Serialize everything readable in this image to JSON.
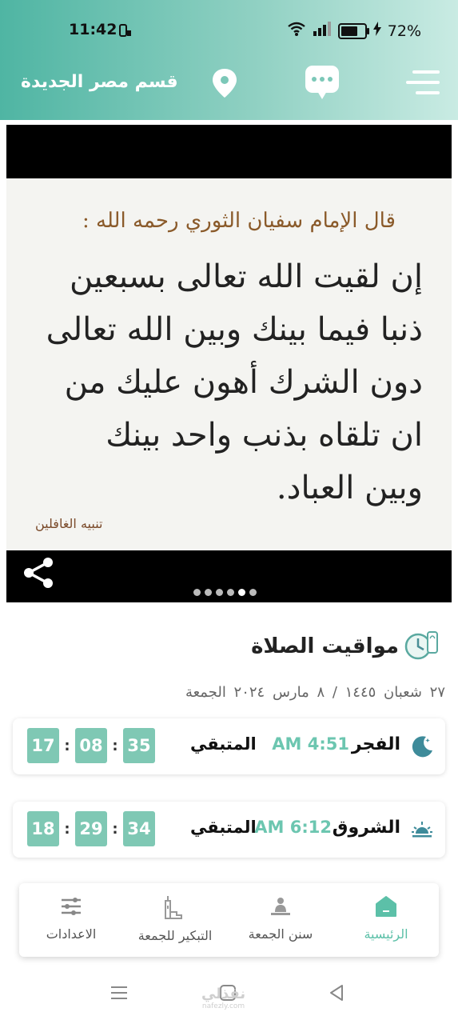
{
  "status": {
    "time": "11:42",
    "battery": "72%",
    "battery_level": 0.72
  },
  "header": {
    "city": "قسم مصر الجديدة",
    "icons": [
      "location-pin-icon",
      "chat-bubble-icon",
      "menu-icon"
    ]
  },
  "banner": {
    "heading": "قال الإمام سفيان الثوري رحمه الله :",
    "lines": [
      "إن لقيت الله تعالى بسبعين",
      "ذنبا فيما بينك وبين الله تعالى",
      "دون الشرك أهون عليك من",
      "ان تلقاه بذنب واحد بينك",
      "وبين العباد."
    ],
    "source": "تنبيه الغافلين",
    "slide_count": 6,
    "active_slide": 5
  },
  "prayers": {
    "title": "مواقيت الصلاة",
    "date": "٢٧ شعبان ١٤٤٥ / ٨ مارس ٢٠٢٤ الجمعة",
    "remaining_label": "المتبقي",
    "items": [
      {
        "name": "الفجر",
        "time": "AM 4:51",
        "countdown": [
          "35",
          "08",
          "17"
        ],
        "icon": "crescent-moon-icon"
      },
      {
        "name": "الشروق",
        "time": "AM 6:12",
        "countdown": [
          "34",
          "29",
          "18"
        ],
        "icon": "sunrise-icon"
      }
    ]
  },
  "nav": {
    "items": [
      {
        "label": "الرئيسية",
        "icon": "home-icon",
        "active": true
      },
      {
        "label": "سنن الجمعة",
        "icon": "prayer-person-icon",
        "active": false
      },
      {
        "label": "التبكير للجمعة",
        "icon": "mosque-icon",
        "active": false
      },
      {
        "label": "الاعدادات",
        "icon": "sliders-icon",
        "active": false
      }
    ]
  },
  "watermark": {
    "text": "نفذلي",
    "sub": "nafezly.com"
  }
}
